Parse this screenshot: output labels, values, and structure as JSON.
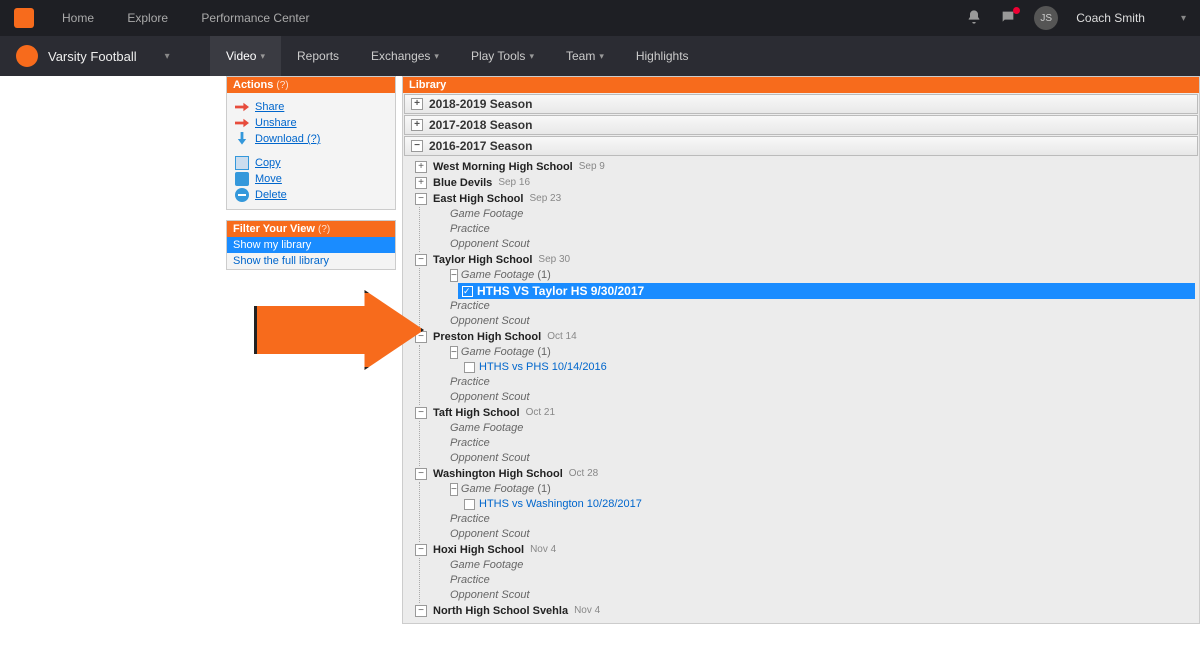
{
  "topbar": {
    "nav": [
      "Home",
      "Explore",
      "Performance Center"
    ],
    "user": {
      "initials": "JS",
      "name": "Coach Smith"
    }
  },
  "secondbar": {
    "team": "Varsity Football",
    "tabs": [
      {
        "label": "Video",
        "dropdown": true,
        "active": true
      },
      {
        "label": "Reports",
        "dropdown": false
      },
      {
        "label": "Exchanges",
        "dropdown": true
      },
      {
        "label": "Play Tools",
        "dropdown": true
      },
      {
        "label": "Team",
        "dropdown": true
      },
      {
        "label": "Highlights",
        "dropdown": false
      }
    ]
  },
  "actions": {
    "title": "Actions",
    "help": "(?)",
    "items": [
      {
        "label": "Share",
        "icon": "share-icon"
      },
      {
        "label": "Unshare",
        "icon": "share-icon"
      },
      {
        "label": "Download (?)",
        "icon": "download-icon"
      },
      {
        "label": "Copy",
        "icon": "copy-icon"
      },
      {
        "label": "Move",
        "icon": "move-icon"
      },
      {
        "label": "Delete",
        "icon": "delete-icon"
      }
    ]
  },
  "filter": {
    "title": "Filter Your View",
    "help": "(?)",
    "items": [
      {
        "label": "Show my library",
        "selected": true
      },
      {
        "label": "Show the full library",
        "selected": false
      }
    ]
  },
  "library": {
    "title": "Library",
    "seasons": [
      {
        "label": "2018-2019 Season",
        "expanded": false
      },
      {
        "label": "2017-2018 Season",
        "expanded": false
      },
      {
        "label": "2016-2017 Season",
        "expanded": true
      }
    ],
    "opponents": [
      {
        "name": "West Morning High School",
        "date": "Sep 9",
        "expanded": false
      },
      {
        "name": "Blue Devils",
        "date": "Sep 16",
        "expanded": false
      },
      {
        "name": "East High School",
        "date": "Sep 23",
        "expanded": true,
        "children": [
          {
            "label": "Game Footage"
          },
          {
            "label": "Practice"
          },
          {
            "label": "Opponent Scout"
          }
        ]
      },
      {
        "name": "Taylor High School",
        "date": "Sep 30",
        "expanded": true,
        "children": [
          {
            "label": "Game Footage",
            "count": "(1)",
            "expanded": true,
            "videos": [
              {
                "label": "HTHS VS Taylor HS 9/30/2017",
                "checked": true,
                "selected": true
              }
            ]
          },
          {
            "label": "Practice"
          },
          {
            "label": "Opponent Scout"
          }
        ]
      },
      {
        "name": "Preston High School",
        "date": "Oct 14",
        "expanded": true,
        "children": [
          {
            "label": "Game Footage",
            "count": "(1)",
            "expanded": true,
            "videos": [
              {
                "label": "HTHS vs PHS 10/14/2016",
                "checked": false
              }
            ]
          },
          {
            "label": "Practice"
          },
          {
            "label": "Opponent Scout"
          }
        ]
      },
      {
        "name": "Taft High School",
        "date": "Oct 21",
        "expanded": true,
        "children": [
          {
            "label": "Game Footage"
          },
          {
            "label": "Practice"
          },
          {
            "label": "Opponent Scout"
          }
        ]
      },
      {
        "name": "Washington High School",
        "date": "Oct 28",
        "expanded": true,
        "children": [
          {
            "label": "Game Footage",
            "count": "(1)",
            "expanded": true,
            "videos": [
              {
                "label": "HTHS vs Washington 10/28/2017",
                "checked": false
              }
            ]
          },
          {
            "label": "Practice"
          },
          {
            "label": "Opponent Scout"
          }
        ]
      },
      {
        "name": "Hoxi High School",
        "date": "Nov 4",
        "expanded": true,
        "children": [
          {
            "label": "Game Footage"
          },
          {
            "label": "Practice"
          },
          {
            "label": "Opponent Scout"
          }
        ]
      },
      {
        "name": "North High School Svehla",
        "date": "Nov 4",
        "expanded": true
      }
    ]
  }
}
